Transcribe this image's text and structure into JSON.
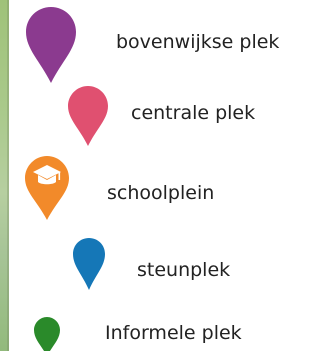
{
  "legend": {
    "items": [
      {
        "label": "bovenwijkse plek",
        "color": "#8b3a8f",
        "icon": "map-pin"
      },
      {
        "label": "centrale plek",
        "color": "#e05070",
        "icon": "map-pin"
      },
      {
        "label": "schoolplein",
        "color": "#f28a2a",
        "icon": "graduation-cap-pin"
      },
      {
        "label": "steunplek",
        "color": "#1577b7",
        "icon": "map-pin"
      },
      {
        "label": "Informele plek",
        "color": "#2a8a2a",
        "icon": "map-pin"
      }
    ]
  }
}
